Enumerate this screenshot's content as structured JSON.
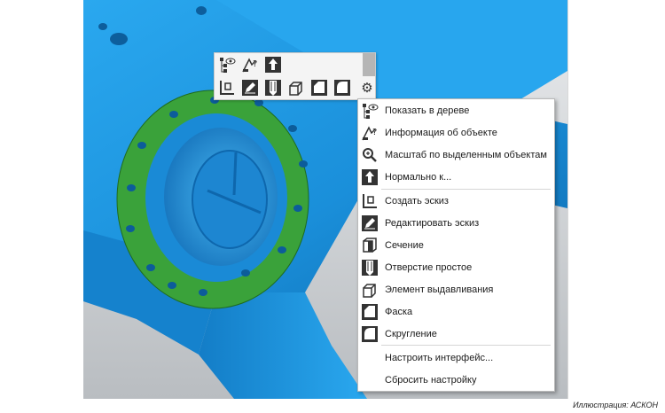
{
  "toolbar": {
    "row1": [
      {
        "name": "show-in-tree-icon"
      },
      {
        "name": "object-info-icon"
      },
      {
        "name": "normal-to-icon"
      }
    ],
    "row2": [
      {
        "name": "create-sketch-icon"
      },
      {
        "name": "edit-sketch-icon"
      },
      {
        "name": "simple-hole-icon"
      },
      {
        "name": "extrude-icon"
      },
      {
        "name": "chamfer-icon"
      },
      {
        "name": "fillet-icon"
      }
    ],
    "settings_icon": "gear-icon"
  },
  "menu": {
    "items": [
      {
        "label": "Показать в дереве",
        "icon": "show-in-tree-icon"
      },
      {
        "label": "Информация об объекте",
        "icon": "object-info-icon"
      },
      {
        "label": "Масштаб по выделенным объектам",
        "icon": "zoom-to-selection-icon"
      },
      {
        "label": "Нормально к...",
        "icon": "normal-to-icon"
      },
      {
        "label": "Создать эскиз",
        "icon": "create-sketch-icon"
      },
      {
        "label": "Редактировать эскиз",
        "icon": "edit-sketch-icon"
      },
      {
        "label": "Сечение",
        "icon": "section-icon"
      },
      {
        "label": "Отверстие простое",
        "icon": "simple-hole-icon"
      },
      {
        "label": "Элемент выдавливания",
        "icon": "extrude-icon"
      },
      {
        "label": "Фаска",
        "icon": "chamfer-icon"
      },
      {
        "label": "Скругление",
        "icon": "fillet-icon"
      },
      {
        "label": "Настроить интерфейс..."
      },
      {
        "label": "Сбросить настройку"
      }
    ]
  },
  "caption": "Иллюстрация: АСКОН",
  "colors": {
    "part_blue": "#1e9ee6",
    "selected_face": "#3aa23a",
    "background_grey": "#c4c8cc"
  }
}
